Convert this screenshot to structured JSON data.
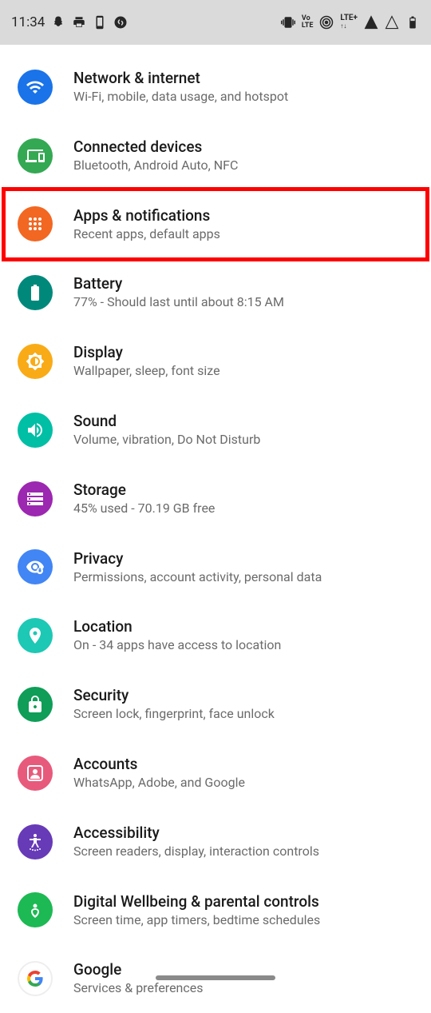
{
  "statusBar": {
    "time": "11:34",
    "network": "LTE+",
    "volte": "VoLTE"
  },
  "settings": [
    {
      "title": "Network & internet",
      "subtitle": "Wi-Fi, mobile, data usage, and hotspot",
      "color": "c-blue",
      "icon": "wifi",
      "name": "row-network-internet"
    },
    {
      "title": "Connected devices",
      "subtitle": "Bluetooth, Android Auto, NFC",
      "color": "c-green",
      "icon": "devices",
      "name": "row-connected-devices"
    },
    {
      "title": "Apps & notifications",
      "subtitle": "Recent apps, default apps",
      "color": "c-orange",
      "icon": "apps",
      "name": "row-apps-notifications",
      "highlight": true
    },
    {
      "title": "Battery",
      "subtitle": "77% - Should last until about 8:15 AM",
      "color": "c-teal",
      "icon": "battery",
      "name": "row-battery"
    },
    {
      "title": "Display",
      "subtitle": "Wallpaper, sleep, font size",
      "color": "c-amber",
      "icon": "brightness",
      "name": "row-display"
    },
    {
      "title": "Sound",
      "subtitle": "Volume, vibration, Do Not Disturb",
      "color": "c-cyan",
      "icon": "sound",
      "name": "row-sound"
    },
    {
      "title": "Storage",
      "subtitle": "45% used - 70.19 GB free",
      "color": "c-purple",
      "icon": "storage",
      "name": "row-storage"
    },
    {
      "title": "Privacy",
      "subtitle": "Permissions, account activity, personal data",
      "color": "c-lblue",
      "icon": "privacy",
      "name": "row-privacy"
    },
    {
      "title": "Location",
      "subtitle": "On - 34 apps have access to location",
      "color": "c-teal2",
      "icon": "location",
      "name": "row-location"
    },
    {
      "title": "Security",
      "subtitle": "Screen lock, fingerprint, face unlock",
      "color": "c-dgreen",
      "icon": "lock",
      "name": "row-security"
    },
    {
      "title": "Accounts",
      "subtitle": "WhatsApp, Adobe, and Google",
      "color": "c-pink",
      "icon": "account",
      "name": "row-accounts"
    },
    {
      "title": "Accessibility",
      "subtitle": "Screen readers, display, interaction controls",
      "color": "c-violet",
      "icon": "a11y",
      "name": "row-accessibility"
    },
    {
      "title": "Digital Wellbeing & parental controls",
      "subtitle": "Screen time, app timers, bedtime schedules",
      "color": "c-green2",
      "icon": "wellbeing",
      "name": "row-digital-wellbeing"
    },
    {
      "title": "Google",
      "subtitle": "Services & preferences",
      "color": "c-white",
      "icon": "google",
      "name": "row-google"
    }
  ]
}
